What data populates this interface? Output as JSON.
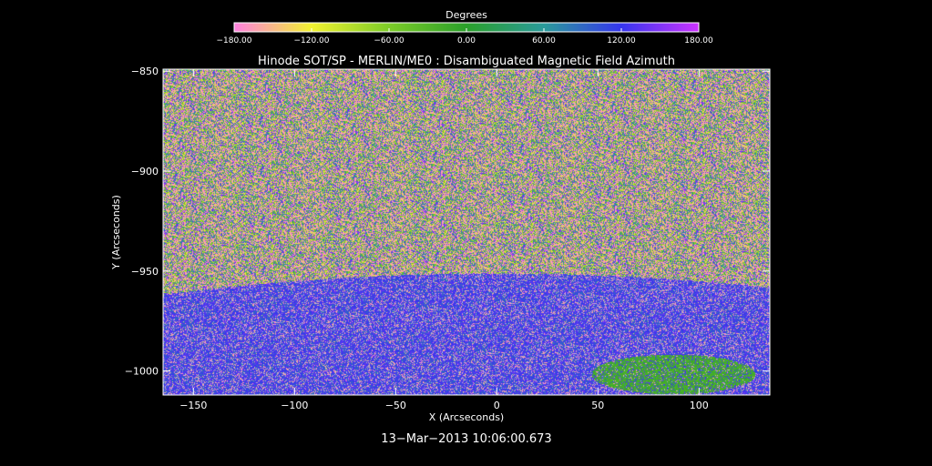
{
  "chart_data": {
    "type": "heatmap",
    "title": "Hinode SOT/SP - MERLIN/ME0 : Disambiguated Magnetic Field Azimuth",
    "xlabel": "X (Arcseconds)",
    "ylabel": "Y (Arcseconds)",
    "xlim": [
      -165,
      135
    ],
    "ylim": [
      -1012,
      -849
    ],
    "x_ticks": [
      -150,
      -100,
      -50,
      0,
      50,
      100
    ],
    "x_tick_labels": [
      "−150",
      "−100",
      "−50",
      "0",
      "50",
      "100"
    ],
    "y_ticks": [
      -850,
      -900,
      -950,
      -1000
    ],
    "y_tick_labels": [
      "−850",
      "−900",
      "−950",
      "−1000"
    ],
    "colorbar": {
      "label": "Degrees",
      "range": [
        -180,
        180
      ],
      "ticks": [
        -180,
        -120,
        -60,
        0,
        60,
        120,
        180
      ],
      "tick_labels": [
        "−180.00",
        "−120.00",
        "−60.00",
        "0.00",
        "60.00",
        "120.00",
        "180.00"
      ],
      "colors": [
        "#ff80e0",
        "#f2f230",
        "#7ccc28",
        "#2aa02a",
        "#2a9a9a",
        "#3535ee",
        "#cc33ff"
      ]
    },
    "timestamp": "13−Mar−2013 10:06:00.673"
  }
}
